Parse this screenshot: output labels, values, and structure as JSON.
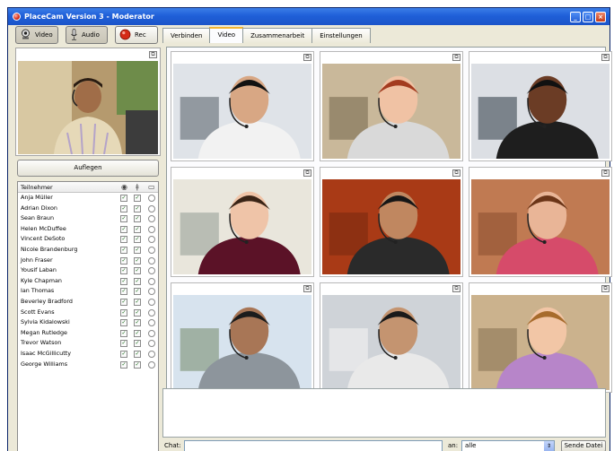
{
  "window": {
    "title": "PlaceCam Version 3 - Moderator",
    "controls": [
      "minimize",
      "maximize",
      "close"
    ]
  },
  "toolbar": {
    "video_label": "Video",
    "audio_label": "Audio",
    "rec_label": "Rec"
  },
  "tabs": [
    {
      "label": "Verbinden",
      "active": false
    },
    {
      "label": "Video",
      "active": true
    },
    {
      "label": "Zusammenarbeit",
      "active": false
    },
    {
      "label": "Einstellungen",
      "active": false
    }
  ],
  "self_view": {
    "hangup_label": "Auflegen"
  },
  "participants": {
    "header": "Teilnehmer",
    "column_icons": [
      "camera-icon",
      "microphone-icon",
      "folder-icon"
    ],
    "rows": [
      {
        "name": "Anja Müller",
        "video": true,
        "audio": true,
        "file": false
      },
      {
        "name": "Adrian Dixon",
        "video": true,
        "audio": true,
        "file": false
      },
      {
        "name": "Sean Braun",
        "video": true,
        "audio": true,
        "file": false
      },
      {
        "name": "Helen McDuffee",
        "video": true,
        "audio": true,
        "file": false
      },
      {
        "name": "Vincent DeSoto",
        "video": true,
        "audio": true,
        "file": false
      },
      {
        "name": "Nicole Brandenburg",
        "video": true,
        "audio": true,
        "file": false
      },
      {
        "name": "John Fraser",
        "video": true,
        "audio": true,
        "file": false
      },
      {
        "name": "Yousif Laban",
        "video": true,
        "audio": true,
        "file": false
      },
      {
        "name": "Kyle Chapman",
        "video": true,
        "audio": true,
        "file": false
      },
      {
        "name": "Ian Thomas",
        "video": true,
        "audio": true,
        "file": false
      },
      {
        "name": "Beverley Bradford",
        "video": true,
        "audio": true,
        "file": false
      },
      {
        "name": "Scott Evans",
        "video": true,
        "audio": true,
        "file": false
      },
      {
        "name": "Sylvia Kidalowski",
        "video": true,
        "audio": true,
        "file": false
      },
      {
        "name": "Megan Rutledge",
        "video": true,
        "audio": true,
        "file": false
      },
      {
        "name": "Trevor Watson",
        "video": true,
        "audio": true,
        "file": false
      },
      {
        "name": "Isaac McGillicutty",
        "video": true,
        "audio": true,
        "file": false
      },
      {
        "name": "George Williams",
        "video": true,
        "audio": true,
        "file": false
      }
    ]
  },
  "chat": {
    "chat_label": "Chat:",
    "to_label": "an:",
    "recipient": "alle",
    "send_file_label": "Sende Datei"
  },
  "colors": {
    "titlebar": "#1f5fd8",
    "window_bg": "#ece9d8",
    "tab_highlight": "#f3b530",
    "rec_red": "#d52b16"
  }
}
